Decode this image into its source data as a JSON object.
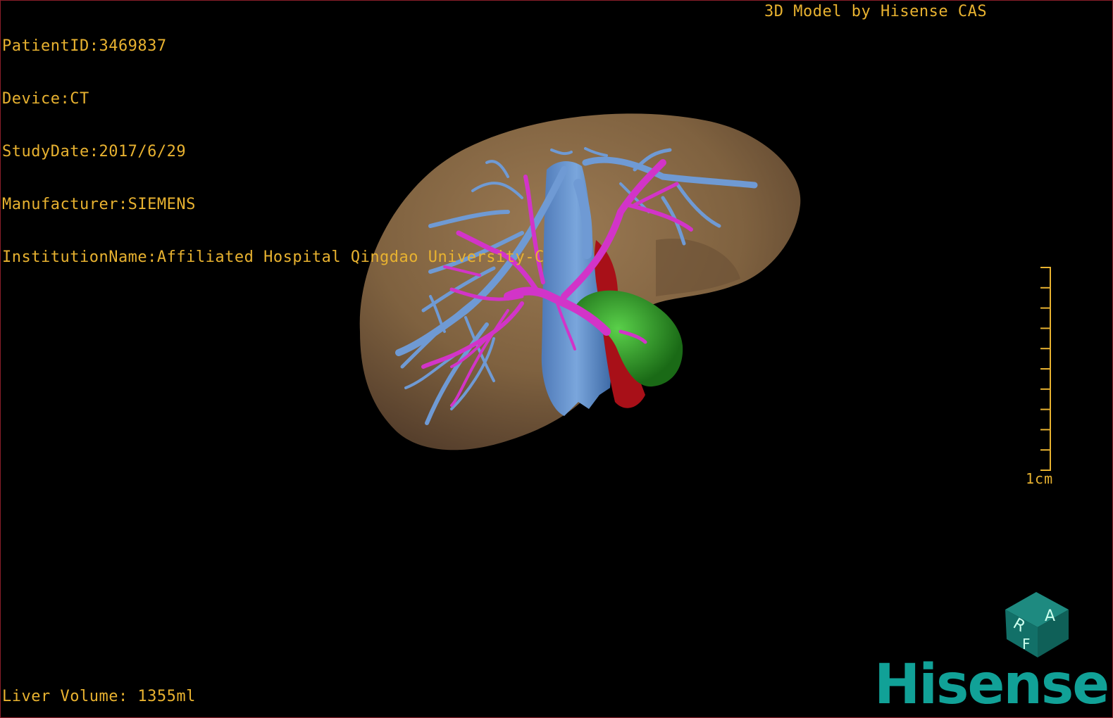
{
  "info": {
    "patient_id": "PatientID:3469837",
    "device": "Device:CT",
    "study_date": "StudyDate:2017/6/29",
    "manufacturer": "Manufacturer:SIEMENS",
    "institution": "InstitutionName:Affiliated Hospital Qingdao University-C"
  },
  "brand_text": "3D Model by Hisense CAS",
  "liver_volume": "Liver Volume: 1355ml",
  "scale": {
    "label": "1cm",
    "ticks": 10
  },
  "orientation_cube": {
    "faces": [
      "R",
      "A",
      "F"
    ]
  },
  "logo": "Hisense",
  "colors": {
    "text": "#e8b230",
    "liver": "#8a6a45",
    "hepatic_vein": "#6f9ad4",
    "portal_vein": "#d234c8",
    "artery": "#a81018",
    "gallbladder": "#2a9a22",
    "logo": "#11a197",
    "border": "#8a1e2a"
  },
  "structures": [
    "liver",
    "hepatic-vein",
    "portal-vein",
    "hepatic-artery",
    "gallbladder",
    "inferior-vena-cava"
  ]
}
